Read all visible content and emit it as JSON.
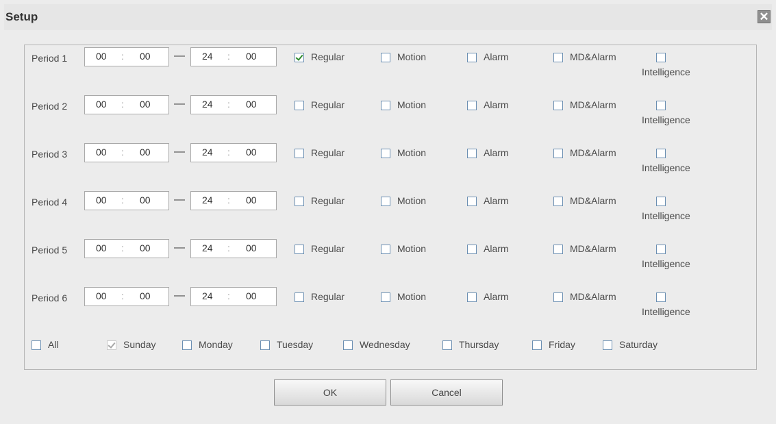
{
  "dialog": {
    "title": "Setup",
    "close_symbol": "✕",
    "close_icon": "close-icon"
  },
  "periods": [
    {
      "label": "Period 1",
      "start_h": "00",
      "start_m": "00",
      "end_h": "24",
      "end_m": "00",
      "regular": true,
      "motion": false,
      "alarm": false,
      "mdalarm": false,
      "intelligence": false
    },
    {
      "label": "Period 2",
      "start_h": "00",
      "start_m": "00",
      "end_h": "24",
      "end_m": "00",
      "regular": false,
      "motion": false,
      "alarm": false,
      "mdalarm": false,
      "intelligence": false
    },
    {
      "label": "Period 3",
      "start_h": "00",
      "start_m": "00",
      "end_h": "24",
      "end_m": "00",
      "regular": false,
      "motion": false,
      "alarm": false,
      "mdalarm": false,
      "intelligence": false
    },
    {
      "label": "Period 4",
      "start_h": "00",
      "start_m": "00",
      "end_h": "24",
      "end_m": "00",
      "regular": false,
      "motion": false,
      "alarm": false,
      "mdalarm": false,
      "intelligence": false
    },
    {
      "label": "Period 5",
      "start_h": "00",
      "start_m": "00",
      "end_h": "24",
      "end_m": "00",
      "regular": false,
      "motion": false,
      "alarm": false,
      "mdalarm": false,
      "intelligence": false
    },
    {
      "label": "Period 6",
      "start_h": "00",
      "start_m": "00",
      "end_h": "24",
      "end_m": "00",
      "regular": false,
      "motion": false,
      "alarm": false,
      "mdalarm": false,
      "intelligence": false
    }
  ],
  "time_separator": ":",
  "range_dash": "—",
  "record_types": {
    "regular": "Regular",
    "motion": "Motion",
    "alarm": "Alarm",
    "mdalarm": "MD&Alarm",
    "intelligence": "Intelligence"
  },
  "days": [
    {
      "key": "all",
      "label": "All",
      "checked": false,
      "disabled": false
    },
    {
      "key": "sunday",
      "label": "Sunday",
      "checked": true,
      "disabled": true
    },
    {
      "key": "monday",
      "label": "Monday",
      "checked": false,
      "disabled": false
    },
    {
      "key": "tuesday",
      "label": "Tuesday",
      "checked": false,
      "disabled": false
    },
    {
      "key": "wednesday",
      "label": "Wednesday",
      "checked": false,
      "disabled": false
    },
    {
      "key": "thursday",
      "label": "Thursday",
      "checked": false,
      "disabled": false
    },
    {
      "key": "friday",
      "label": "Friday",
      "checked": false,
      "disabled": false
    },
    {
      "key": "saturday",
      "label": "Saturday",
      "checked": false,
      "disabled": false
    }
  ],
  "buttons": {
    "ok": "OK",
    "cancel": "Cancel"
  },
  "colors": {
    "check_mark": "#2e8b2e",
    "checkbox_border": "#6b8fb2"
  }
}
